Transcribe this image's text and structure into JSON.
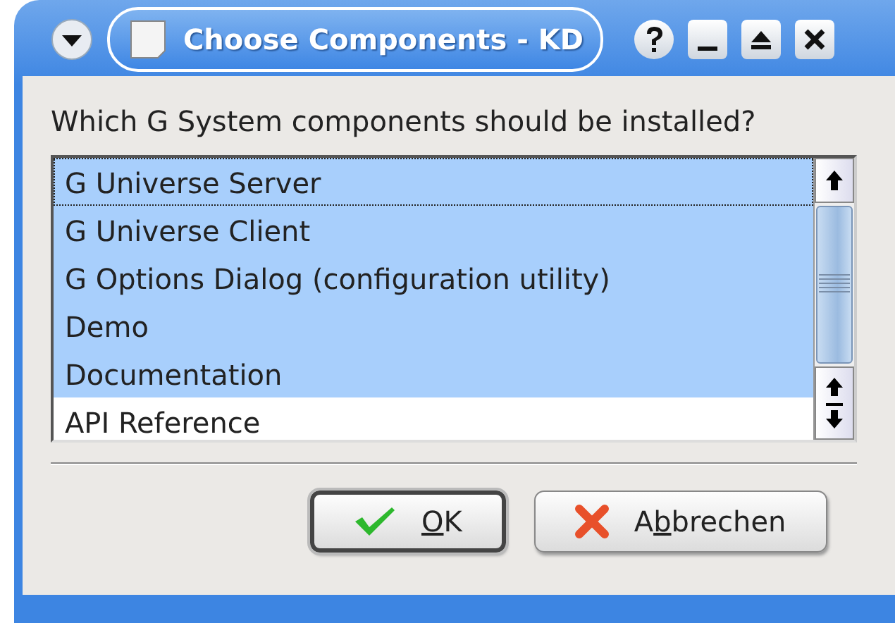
{
  "window": {
    "title": "Choose Components - KD"
  },
  "prompt": "Which G System components should be installed?",
  "list": {
    "items": [
      {
        "label": "G Universe Server",
        "selected": true,
        "focused": true
      },
      {
        "label": "G Universe Client",
        "selected": true,
        "focused": false
      },
      {
        "label": "G Options Dialog (configuration utility)",
        "selected": true,
        "focused": false
      },
      {
        "label": "Demo",
        "selected": true,
        "focused": false
      },
      {
        "label": "Documentation",
        "selected": true,
        "focused": false
      },
      {
        "label": "API Reference",
        "selected": false,
        "focused": false
      }
    ]
  },
  "buttons": [
    {
      "kind": "ok",
      "key": "O",
      "rest": "K",
      "default": true
    },
    {
      "kind": "cancel",
      "lead": "A",
      "key": "b",
      "rest": "brechen",
      "default": false
    }
  ]
}
